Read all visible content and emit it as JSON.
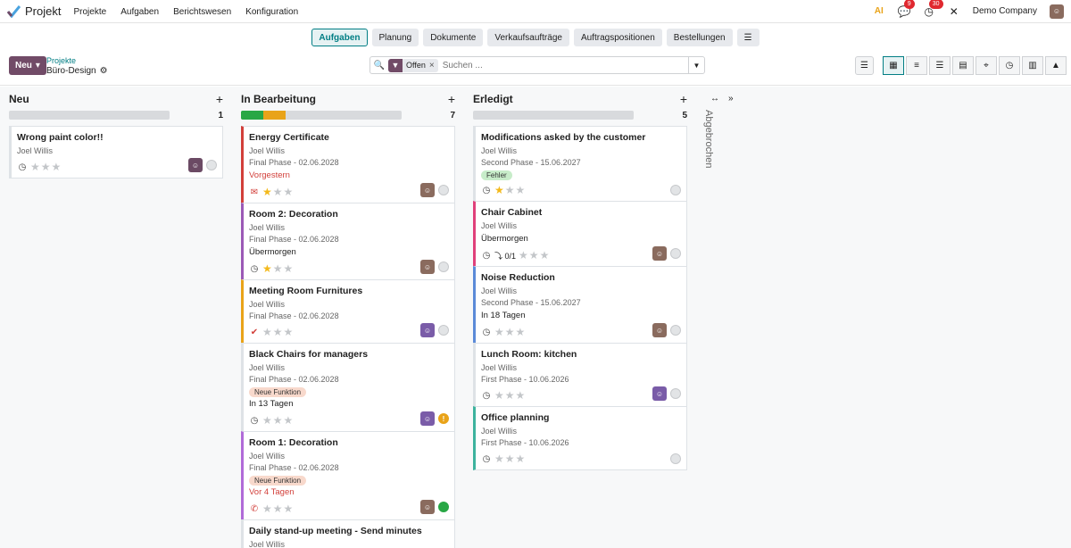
{
  "app": {
    "title": "Projekt",
    "menu": [
      "Projekte",
      "Aufgaben",
      "Berichtswesen",
      "Konfiguration"
    ],
    "company": "Demo Company",
    "chat_count": "9",
    "activity_count": "30",
    "accent": "#714b67",
    "teal": "#017e84"
  },
  "tabs": [
    {
      "label": "Aufgaben",
      "active": true
    },
    {
      "label": "Planung"
    },
    {
      "label": "Dokumente"
    },
    {
      "label": "Verkaufsaufträge"
    },
    {
      "label": "Auftragspositionen"
    },
    {
      "label": "Bestellungen"
    }
  ],
  "control": {
    "new_label": "Neu",
    "crumb_parent": "Projekte",
    "crumb_current": "Büro-Design",
    "facet": "Offen",
    "search_placeholder": "Suchen ..."
  },
  "columns": [
    {
      "title": "Neu",
      "count": "1",
      "progress": {
        "green": 0,
        "orange": 0
      },
      "cards": [
        {
          "title": "Wrong paint color!!",
          "sub": [
            "Joel Willis"
          ],
          "stars": 0,
          "border": "#dee2e6",
          "icon": "clock",
          "avatar": "camera",
          "status": "grey"
        }
      ]
    },
    {
      "title": "In Bearbeitung",
      "count": "7",
      "progress": {
        "green": 14,
        "orange": 14
      },
      "cards": [
        {
          "title": "Energy Certificate",
          "sub": [
            "Joel Willis",
            "Final Phase - 02.06.2028"
          ],
          "deadline": "Vorgestern",
          "deadline_red": true,
          "stars": 1,
          "border": "#d23f3a",
          "icon": "mail",
          "avatar": "face",
          "status": "grey"
        },
        {
          "title": "Room 2: Decoration",
          "sub": [
            "Joel Willis",
            "Final Phase - 02.06.2028"
          ],
          "deadline": "Übermorgen",
          "stars": 1,
          "border": "#9b59b6",
          "icon": "clock",
          "avatar": "face",
          "status": "grey"
        },
        {
          "title": "Meeting Room Furnitures",
          "sub": [
            "Joel Willis",
            "Final Phase - 02.06.2028"
          ],
          "stars": 0,
          "border": "#e9a319",
          "icon": "check",
          "avatar": "face2",
          "status": "grey"
        },
        {
          "title": "Black Chairs for managers",
          "sub": [
            "Joel Willis",
            "Final Phase - 02.06.2028"
          ],
          "tag": "Neue Funktion",
          "tag_color": "#f8d9cc",
          "deadline": "In 13 Tagen",
          "stars": 0,
          "border": "#dee2e6",
          "icon": "clock",
          "avatar": "face2",
          "status": "warn"
        },
        {
          "title": "Room 1: Decoration",
          "sub": [
            "Joel Willis",
            "Final Phase - 02.06.2028"
          ],
          "tag": "Neue Funktion",
          "tag_color": "#f8d9cc",
          "deadline": "Vor 4 Tagen",
          "deadline_red": true,
          "stars": 0,
          "border": "#b06ad8",
          "icon": "phone",
          "avatar": "face",
          "status": "green"
        },
        {
          "title": "Daily stand-up meeting - Send minutes",
          "sub": [
            "Joel Willis"
          ],
          "stars": 0,
          "border": "#dee2e6",
          "icon": "clock",
          "status": "grey"
        }
      ]
    },
    {
      "title": "Erledigt",
      "count": "5",
      "progress": {
        "green": 0,
        "orange": 0
      },
      "cards": [
        {
          "title": "Modifications asked by the customer",
          "sub": [
            "Joel Willis",
            "Second Phase - 15.06.2027"
          ],
          "tag": "Fehler",
          "tag_color": "#c7ecc9",
          "stars": 1,
          "border": "#dee2e6",
          "icon": "clock",
          "status": "grey"
        },
        {
          "title": "Chair Cabinet",
          "sub": [
            "Joel Willis"
          ],
          "deadline": "Übermorgen",
          "subtasks": "0/1",
          "stars": 0,
          "border": "#e0407a",
          "icon": "clock",
          "avatar": "face",
          "status": "grey"
        },
        {
          "title": "Noise Reduction",
          "sub": [
            "Joel Willis",
            "Second Phase - 15.06.2027"
          ],
          "deadline": "In 18 Tagen",
          "stars": 0,
          "border": "#5b8ad8",
          "icon": "clock",
          "avatar": "face",
          "status": "grey"
        },
        {
          "title": "Lunch Room: kitchen",
          "sub": [
            "Joel Willis",
            "First Phase - 10.06.2026"
          ],
          "stars": 0,
          "border": "#dee2e6",
          "icon": "clock",
          "avatar": "face2",
          "status": "grey"
        },
        {
          "title": "Office planning",
          "sub": [
            "Joel Willis",
            "First Phase - 10.06.2026"
          ],
          "stars": 0,
          "border": "#3db39e",
          "icon": "clock",
          "status": "grey"
        }
      ]
    }
  ],
  "folded": {
    "title": "Abgebrochen"
  }
}
